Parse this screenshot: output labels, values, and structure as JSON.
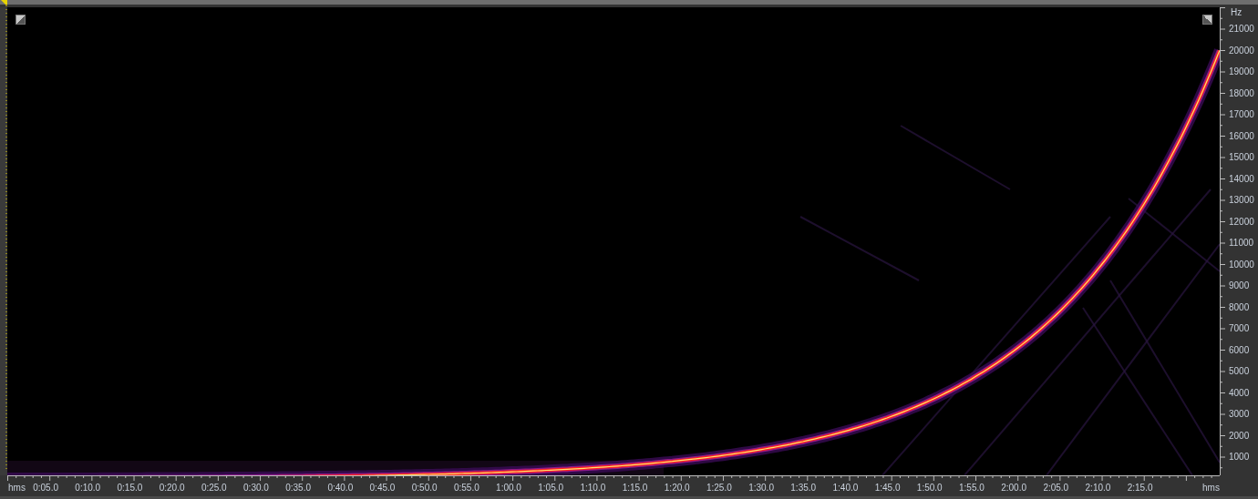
{
  "frequency_axis": {
    "unit": "Hz",
    "ticks": [
      "21000",
      "20000",
      "19000",
      "18000",
      "17000",
      "16000",
      "15000",
      "14000",
      "13000",
      "12000",
      "11000",
      "10000",
      "9000",
      "8000",
      "7000",
      "6000",
      "5000",
      "4000",
      "3000",
      "2000",
      "1000"
    ]
  },
  "time_axis": {
    "unit_left": "hms",
    "unit_right": "hms",
    "ticks": [
      "0:05.0",
      "0:10.0",
      "0:15.0",
      "0:20.0",
      "0:25.0",
      "0:30.0",
      "0:35.0",
      "0:40.0",
      "0:45.0",
      "0:50.0",
      "0:55.0",
      "1:00.0",
      "1:05.0",
      "1:10.0",
      "1:15.0",
      "1:20.0",
      "1:25.0",
      "1:30.0",
      "1:35.0",
      "1:40.0",
      "1:45.0",
      "1:50.0",
      "1:55.0",
      "2:00.0",
      "2:05.0",
      "2:10.0",
      "2:15.0"
    ]
  }
}
